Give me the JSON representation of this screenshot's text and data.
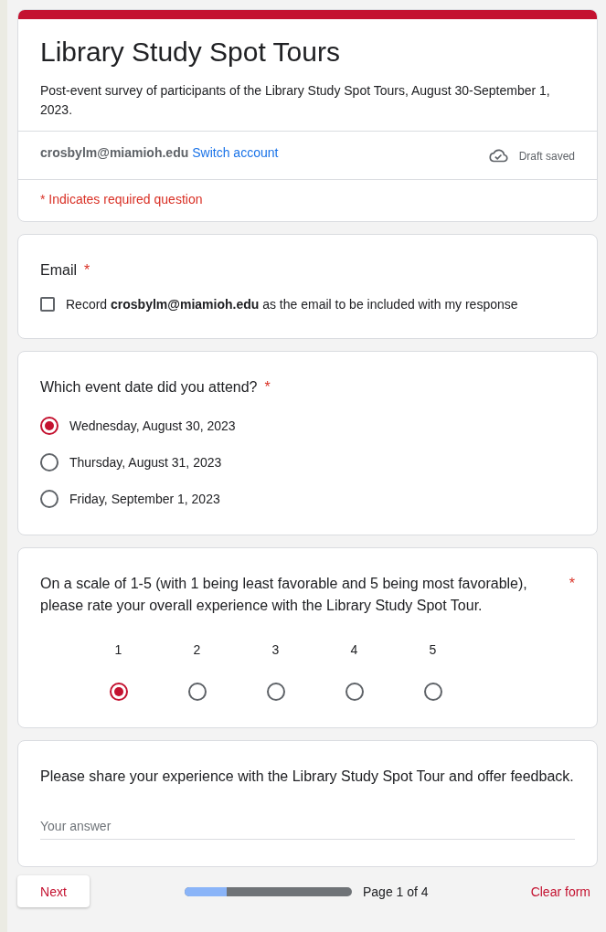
{
  "header": {
    "title": "Library Study Spot Tours",
    "description": "Post-event survey of participants of the Library Study Spot Tours, August 30-September 1, 2023.",
    "account": "crosbylm@miamioh.edu",
    "switch_link": "Switch account",
    "draft_status": "Draft saved",
    "required_note": "* Indicates required question"
  },
  "questions": [
    {
      "kind": "checkbox",
      "title": "Email",
      "required_mark": "*",
      "options": [
        {
          "label": "Record **crosbylm@miamioh.edu** as the email to be included with my response",
          "checked": false
        }
      ]
    },
    {
      "kind": "radio",
      "title": "Which event date did you attend?",
      "required_mark": "*",
      "options": [
        {
          "label": "Wednesday, August 30, 2023",
          "selected": true
        },
        {
          "label": "Thursday, August 31, 2023",
          "selected": false
        },
        {
          "label": "Friday, September 1, 2023",
          "selected": false
        }
      ]
    },
    {
      "kind": "scale",
      "title": "On a scale of 1-5 (with 1 being least favorable and 5 being most favorable), please rate your overall experience with the Library Study Spot Tour.",
      "required_mark": "*",
      "options": [
        {
          "label": "1",
          "selected": true
        },
        {
          "label": "2",
          "selected": false
        },
        {
          "label": "3",
          "selected": false
        },
        {
          "label": "4",
          "selected": false
        },
        {
          "label": "5",
          "selected": false
        }
      ]
    },
    {
      "kind": "text",
      "title": "Please share your experience with the Library Study Spot Tour and offer feedback.",
      "placeholder": "Your answer"
    }
  ],
  "footer": {
    "next_button": "Next",
    "progress": {
      "level": 0.25
    },
    "page_label": "Page 1 of 4",
    "clear_button": "Clear form"
  }
}
